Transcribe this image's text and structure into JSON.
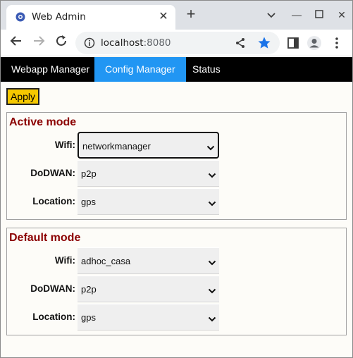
{
  "browser": {
    "tab_title": "Web Admin",
    "url_host": "localhost",
    "url_port": ":8080",
    "accent_color": "#1a73e8"
  },
  "nav": {
    "items": [
      {
        "label": "Webapp Manager"
      },
      {
        "label": "Config Manager"
      },
      {
        "label": "Status"
      }
    ],
    "active_index": 1,
    "active_color": "#2196f3"
  },
  "actions": {
    "apply_label": "Apply",
    "apply_color": "#f5c800"
  },
  "sections": [
    {
      "title": "Active mode",
      "fields": [
        {
          "label": "Wifi:",
          "value": "networkmanager",
          "focused": true
        },
        {
          "label": "DoDWAN:",
          "value": "p2p"
        },
        {
          "label": "Location:",
          "value": "gps"
        }
      ]
    },
    {
      "title": "Default mode",
      "fields": [
        {
          "label": "Wifi:",
          "value": "adhoc_casa"
        },
        {
          "label": "DoDWAN:",
          "value": "p2p"
        },
        {
          "label": "Location:",
          "value": "gps"
        }
      ]
    }
  ],
  "icons": {
    "tab_favicon": "gear-icon",
    "tab_close": "close-icon",
    "new_tab": "plus-icon",
    "back": "back-arrow-icon",
    "forward": "forward-arrow-icon",
    "reload": "reload-icon",
    "info": "info-icon",
    "share": "share-icon",
    "bookmark": "star-icon",
    "side_panel": "side-panel-icon",
    "profile": "profile-icon",
    "menu": "kebab-menu-icon"
  },
  "title_color": "#8b0000"
}
